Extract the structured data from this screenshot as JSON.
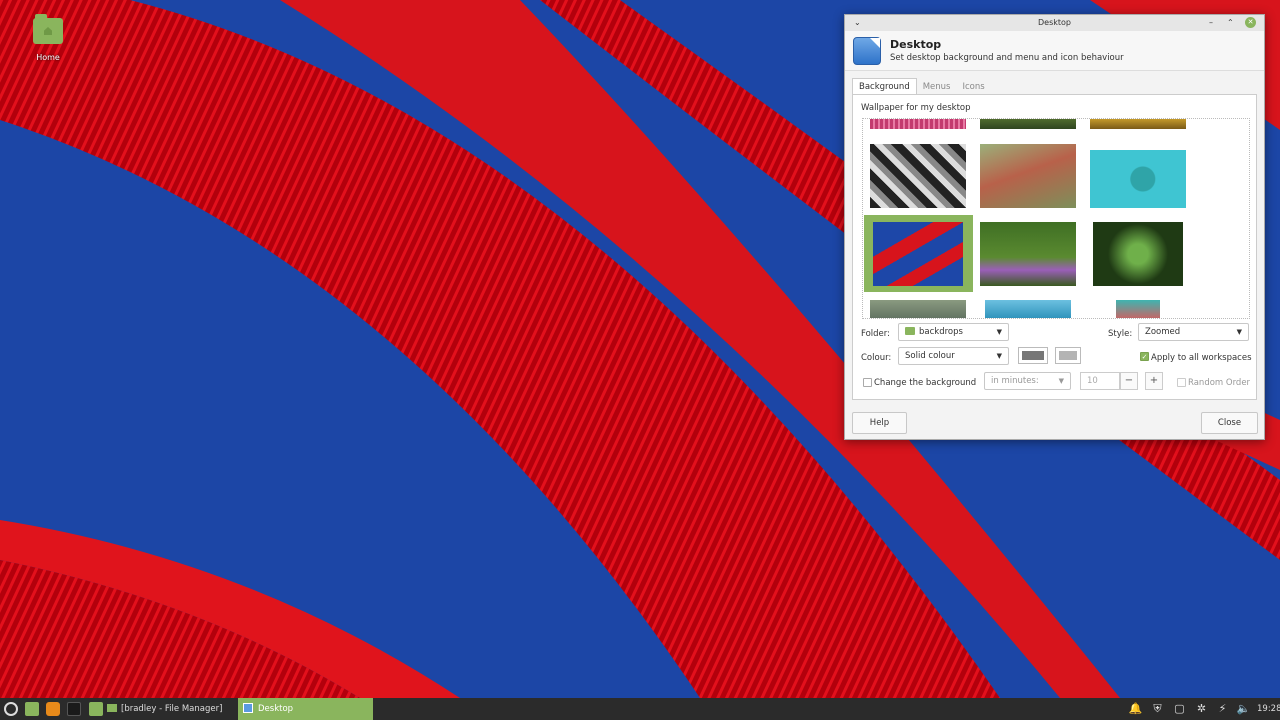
{
  "desktop": {
    "icons": [
      {
        "label": "Home",
        "icon": "home-folder-icon"
      }
    ]
  },
  "window": {
    "title": "Desktop",
    "controls": {
      "menu": "⌄",
      "minimize": "–",
      "maximize": "⌃",
      "close": "✕"
    },
    "header": {
      "title": "Desktop",
      "subtitle": "Set desktop background and menu and icon behaviour",
      "icon": "desktop-settings-icon"
    },
    "tabs": [
      {
        "label": "Background",
        "active": true
      },
      {
        "label": "Menus",
        "active": false
      },
      {
        "label": "Icons",
        "active": false
      }
    ],
    "background": {
      "wallpaper_label": "Wallpaper for my desktop",
      "folder_label": "Folder:",
      "folder_value": "backdrops",
      "style_label": "Style:",
      "style_value": "Zoomed",
      "colour_label": "Colour:",
      "colour_value": "Solid colour",
      "colour_primary": "#777777",
      "colour_secondary": "#b4b4b4",
      "apply_all_label": "Apply to all workspaces",
      "apply_all_checked": true,
      "change_bg_label": "Change the background",
      "change_bg_checked": false,
      "interval_value": "in minutes:",
      "interval_number": "10",
      "minus": "−",
      "plus": "+",
      "random_order_label": "Random Order",
      "random_order_checked": false
    },
    "buttons": {
      "help": "Help",
      "close": "Close"
    }
  },
  "taskbar": {
    "items": [
      {
        "label": "[bradley - File Manager]",
        "icon": "folder-icon"
      },
      {
        "label": "Desktop",
        "icon": "desktop-settings-icon",
        "active": true
      }
    ],
    "clock": "19:28",
    "accent": "#8ab55d"
  }
}
